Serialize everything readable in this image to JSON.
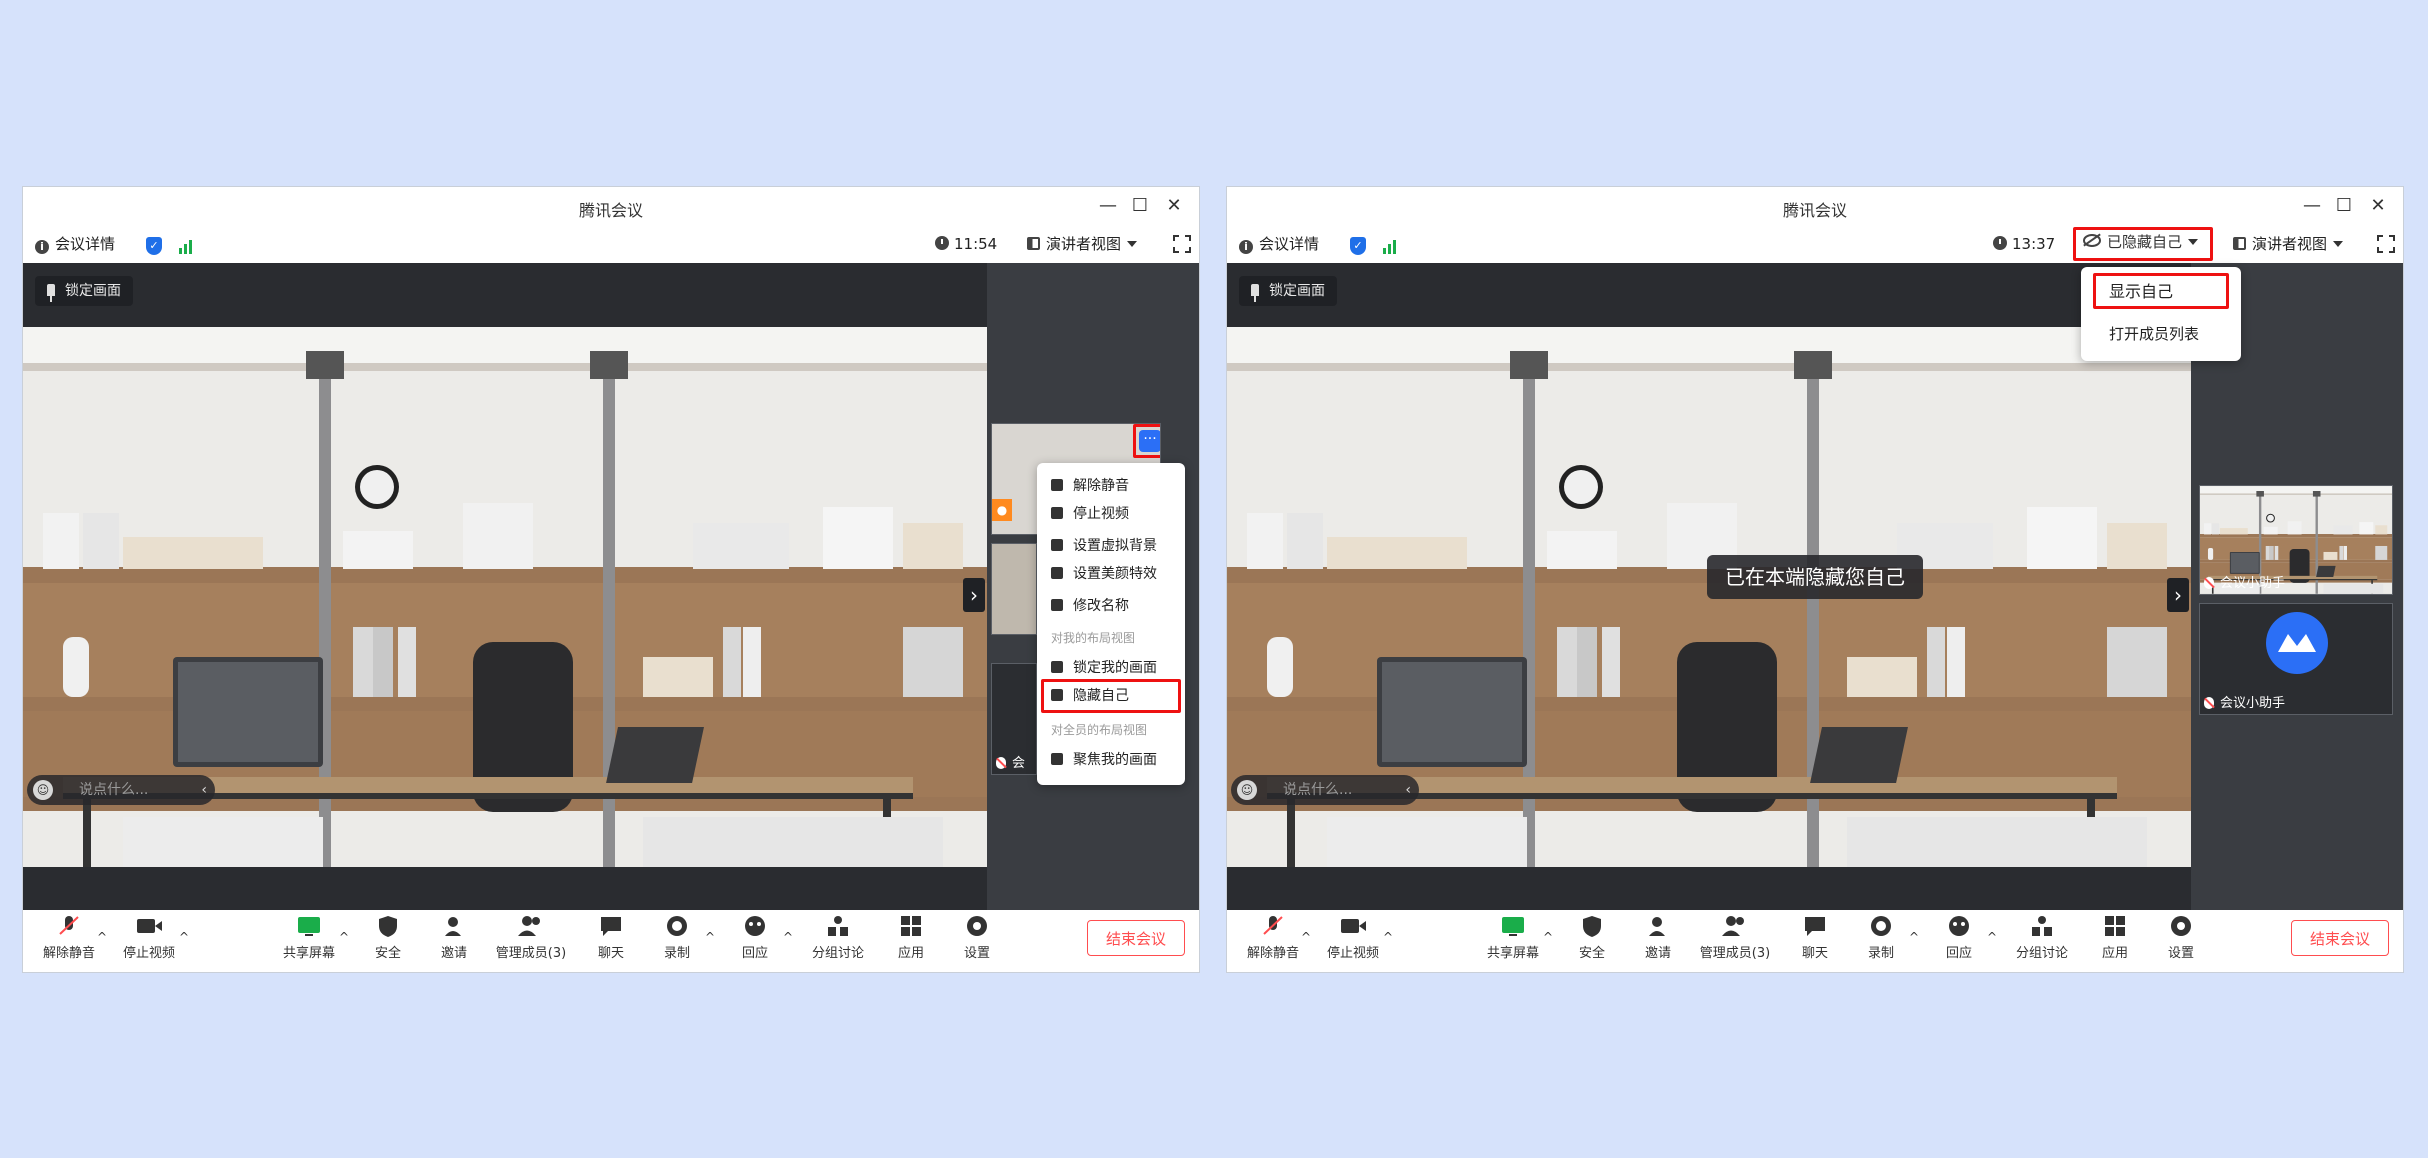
{
  "left": {
    "window_title": "腾讯会议",
    "meeting_details": "会议详情",
    "time": "11:54",
    "view_mode": "演讲者视图",
    "lock_screen": "锁定画面",
    "chat_placeholder": "说点什么...",
    "participant_name": "会",
    "context_menu": {
      "items": [
        {
          "label": "解除静音",
          "icon": "mic-icon"
        },
        {
          "label": "停止视频",
          "icon": "video-icon"
        },
        {
          "label": "设置虚拟背景",
          "icon": "background-icon"
        },
        {
          "label": "设置美颜特效",
          "icon": "beauty-icon"
        },
        {
          "label": "修改名称",
          "icon": "edit-icon"
        },
        {
          "label": "锁定我的画面",
          "icon": "pin-icon"
        },
        {
          "label": "隐藏自己",
          "icon": "eye-slash-icon"
        },
        {
          "label": "聚焦我的画面",
          "icon": "focus-icon"
        }
      ],
      "section_my_layout": "对我的布局视图",
      "section_all_layout": "对全员的布局视图"
    },
    "more_button": "···"
  },
  "right": {
    "window_title": "腾讯会议",
    "meeting_details": "会议详情",
    "time": "13:37",
    "hidden_self": "已隐藏自己",
    "view_mode": "演讲者视图",
    "lock_screen": "锁定画面",
    "chat_placeholder": "说点什么...",
    "toast": "已在本端隐藏您自己",
    "dropdown": {
      "show_self": "显示自己",
      "open_member_list": "打开成员列表"
    },
    "thumbnails": [
      {
        "name": "会议小助手"
      },
      {
        "name": "会议小助手"
      }
    ]
  },
  "toolbar": {
    "unmute": "解除静音",
    "stop_video": "停止视频",
    "share_screen": "共享屏幕",
    "security": "安全",
    "invite": "邀请",
    "manage_members": "管理成员(3)",
    "chat": "聊天",
    "record": "录制",
    "react": "回应",
    "breakout": "分组讨论",
    "apps": "应用",
    "settings": "设置",
    "end_meeting": "结束会议"
  },
  "colors": {
    "background": "#d6e2fb",
    "accent_blue": "#2b6ff6",
    "highlight_red": "#e11111",
    "end_red": "#ff4d4f",
    "signal_green": "#1aad4a"
  }
}
